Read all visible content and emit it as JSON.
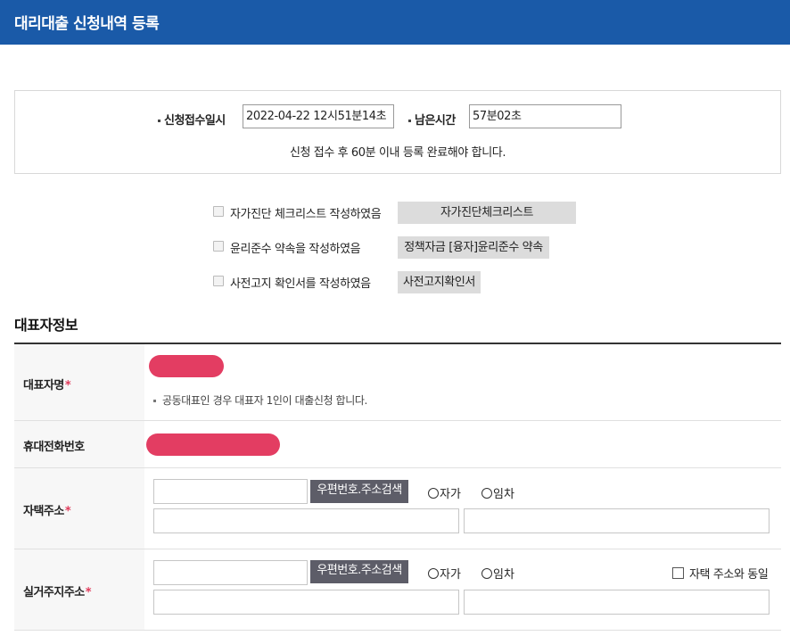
{
  "header": {
    "title": "대리대출 신청내역 등록"
  },
  "application": {
    "received_label": "신청접수일시",
    "received_value": "2022-04-22 12시51분14초",
    "remaining_label": "남은시간",
    "remaining_value": "57분02초",
    "notice": "신청 접수 후 60분 이내 등록 완료해야 합니다."
  },
  "checklist": [
    {
      "text": "자가진단 체크리스트 작성하였음",
      "button": "자가진단체크리스트",
      "checked": false
    },
    {
      "text": "윤리준수 약속을 작성하였음",
      "button": "정책자금 [융자]윤리준수 약속",
      "checked": false
    },
    {
      "text": "사전고지 확인서를 작성하였음",
      "button": "사전고지확인서",
      "checked": false
    }
  ],
  "section": {
    "title": "대표자정보"
  },
  "rep": {
    "name_label": "대표자명",
    "required_mark": "*",
    "name_hint": "공동대표인 경우 대표자 1인이 대출신청 합니다.",
    "phone_label": "휴대전화번호",
    "home_label": "자택주소",
    "residence_label": "실거주지주소",
    "zip_button": "우편번호.주소검색",
    "radio_own": "자가",
    "radio_rent": "임차",
    "same_as_home": "자택 주소와 동일"
  },
  "colors": {
    "header": "#1a5aa8",
    "redaction": "#e33d62",
    "required": "#e03b5b",
    "zip_button": "#5d5d68"
  }
}
